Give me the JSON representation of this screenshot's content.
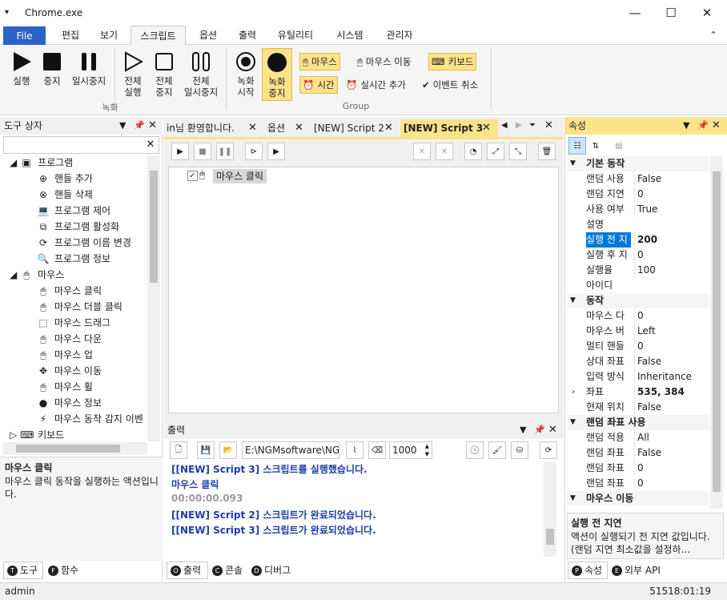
{
  "window": {
    "title": "Chrome.exe",
    "menu_glyph": "▾",
    "min": "—",
    "max": "☐",
    "close": "✕"
  },
  "menu": {
    "file": "File",
    "items": [
      "편집",
      "보기",
      "스크립트",
      "옵션",
      "출력",
      "유틸리티",
      "시스템",
      "관리자"
    ],
    "collapse": "⌃"
  },
  "ribbon": {
    "run": "실행",
    "stop": "중지",
    "pause": "일시중지",
    "run_all": "전체\n실행",
    "stop_all": "전체\n중지",
    "pause_all": "전체\n일시중지",
    "rec_start": "녹화\n시작",
    "rec_stop": "녹화\n중지",
    "mouse": "마우스",
    "mouse_move": "마우스 이동",
    "keyboard": "키보드",
    "time": "시간",
    "realtime_add": "실시간 추가",
    "event_cancel": "이벤트 취소",
    "group_record": "녹화",
    "group_group": "Group"
  },
  "toolbox": {
    "title": "도구 상자",
    "program": "프로그램",
    "program_items": [
      "핸들 추가",
      "핸들 삭제",
      "프로그램 제어",
      "프로그램 활성화",
      "프로그램 이름 변경",
      "프로그램 정보"
    ],
    "mouse": "마우스",
    "mouse_items": [
      "마우스 클릭",
      "마우스 더블 클릭",
      "마우스 드래그",
      "마우스 다운",
      "마우스 업",
      "마우스 이동",
      "마우스 휠",
      "마우스 정보",
      "마우스 동작 감지 이벤"
    ],
    "keyboard": "키보드",
    "desc_title": "마우스 클릭",
    "desc_body": "마우스 클릭 동작을 실행하는 액션입니다.",
    "tabs": {
      "tools": "도구",
      "functions": "함수"
    },
    "tab_letters": {
      "tools": "T",
      "functions": "F"
    }
  },
  "doc_tabs": [
    "in님 환영합니다.",
    "옵션",
    "[NEW] Script 2",
    "[NEW] Script 3"
  ],
  "script": {
    "item": "마우스 클릭",
    "checked": "✓"
  },
  "output": {
    "title": "출력",
    "path": "E:\\NGMsoftware\\NG",
    "count": "1000",
    "lines": [
      {
        "text": "[[NEW] Script 3] 스크립트를 실행했습니다.",
        "color": "#1c3fa8"
      },
      {
        "text": "마우스 클릭",
        "color": "#1c3fa8"
      },
      {
        "text": "00:00:00.093",
        "color": "#9a9a9a"
      },
      {
        "text": "[[NEW] Script 2] 스크립트가 완료되었습니다.",
        "color": "#1c3fa8"
      },
      {
        "text": "[[NEW] Script 3] 스크립트가 완료되었습니다.",
        "color": "#1c3fa8"
      }
    ],
    "tabs": {
      "output": "출력",
      "console": "콘솔",
      "debug": "디버그"
    },
    "tab_letters": {
      "output": "O",
      "console": "C",
      "debug": "D"
    }
  },
  "properties": {
    "title": "속성",
    "cat_basic": "기본 동작",
    "basic": [
      {
        "k": "랜덤 사용",
        "v": "False"
      },
      {
        "k": "랜덤 지연",
        "v": "0"
      },
      {
        "k": "사용 여부",
        "v": "True"
      },
      {
        "k": "설명",
        "v": ""
      },
      {
        "k": "실행 전 지",
        "v": "200"
      },
      {
        "k": "실행 후 지",
        "v": "0"
      },
      {
        "k": "실행율",
        "v": "100"
      },
      {
        "k": "아이디",
        "v": ""
      }
    ],
    "cat_action": "동작",
    "action": [
      {
        "k": "마우스 다",
        "v": "0"
      },
      {
        "k": "마우스 버",
        "v": "Left"
      },
      {
        "k": "멀티 핸들",
        "v": "0"
      },
      {
        "k": "상대 좌표",
        "v": "False"
      },
      {
        "k": "입력 방식",
        "v": "Inheritance"
      },
      {
        "k": "좌표",
        "v": "535, 384"
      },
      {
        "k": "현재 위치",
        "v": "False"
      }
    ],
    "cat_random": "랜덤 좌표 사용",
    "random": [
      {
        "k": "랜덤 적용",
        "v": "All"
      },
      {
        "k": "랜덤 좌표",
        "v": "False"
      },
      {
        "k": "랜덤 좌표",
        "v": "0"
      },
      {
        "k": "랜덤 좌표",
        "v": "0"
      }
    ],
    "cat_move": "마우스 이동",
    "desc_title": "실행 전 지연",
    "desc_body": "액션이 실행되기 전 지연 값입니다. (랜덤 지연 최소값을 설정하...",
    "tabs": {
      "props": "속성",
      "external": "외부 API"
    },
    "tab_letters": {
      "props": "P",
      "external": "E"
    }
  },
  "status": {
    "user": "admin",
    "time": "51518:01:19"
  },
  "colors": {
    "accent": "#2b63c6",
    "highlight": "#fbe38a",
    "selected": "#0078d7"
  }
}
